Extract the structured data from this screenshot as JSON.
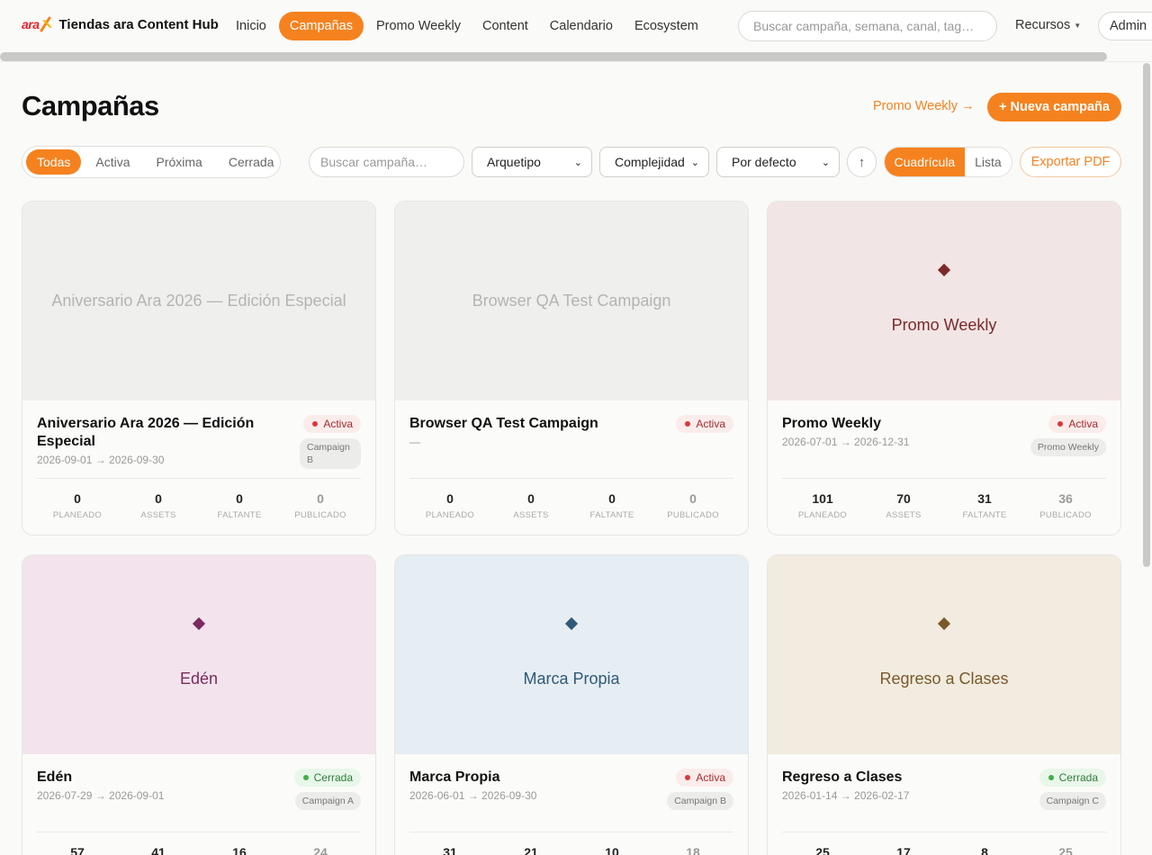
{
  "brand": {
    "logo_text": "ara",
    "title": "Tiendas ara Content Hub"
  },
  "nav": [
    {
      "label": "Inicio",
      "active": false
    },
    {
      "label": "Campañas",
      "active": true
    },
    {
      "label": "Promo Weekly",
      "active": false
    },
    {
      "label": "Content",
      "active": false
    },
    {
      "label": "Calendario",
      "active": false
    },
    {
      "label": "Ecosystem",
      "active": false
    }
  ],
  "top_search": {
    "placeholder": "Buscar campaña, semana, canal, tag…"
  },
  "resources_menu": {
    "label": "Recursos"
  },
  "user_menu": {
    "label": "Admin"
  },
  "header": {
    "title": "Campañas",
    "promo_link": "Promo Weekly →",
    "new_button": "+ Nueva campaña"
  },
  "filters": {
    "status_tabs": [
      {
        "label": "Todas",
        "active": true
      },
      {
        "label": "Activa",
        "active": false
      },
      {
        "label": "Próxima",
        "active": false
      },
      {
        "label": "Cerrada",
        "active": false
      }
    ],
    "search_placeholder": "Buscar campaña…",
    "archetype_select": "Arquetipo",
    "complexity_select": "Complejidad",
    "sort_select": "Por defecto",
    "sort_direction_icon": "↑",
    "view_grid": "Cuadrícula",
    "view_list": "Lista",
    "export": "Exportar PDF"
  },
  "colors": {
    "accent": "#f5821f",
    "active_badge": "#d83a3a",
    "closed_badge": "#3fae4b"
  },
  "stat_labels": [
    "PLANEADO",
    "ASSETS",
    "FALTANTE",
    "PUBLICADO"
  ],
  "campaigns": [
    {
      "cover_title": "Aniversario Ara 2026 — Edición Especial",
      "cover_color": "#efefed",
      "diamond_color": "",
      "title": "Aniversario Ara 2026 — Edición Especial",
      "dates": "2026-09-01 → 2026-09-30",
      "status": "Activa",
      "archetype": "Campaign B",
      "stats": [
        0,
        0,
        0,
        0
      ]
    },
    {
      "cover_title": "Browser QA Test Campaign",
      "cover_color": "#efefed",
      "diamond_color": "",
      "title": "Browser QA Test Campaign",
      "dates": "—",
      "status": "Activa",
      "archetype": "",
      "stats": [
        0,
        0,
        0,
        0
      ]
    },
    {
      "cover_title": "Promo Weekly",
      "cover_color": "#f2e5e5",
      "diamond_color": "#7a2a2a",
      "title": "Promo Weekly",
      "dates": "2026-07-01 → 2026-12-31",
      "status": "Activa",
      "archetype": "Promo Weekly",
      "stats": [
        101,
        70,
        31,
        36
      ]
    },
    {
      "cover_title": "Edén",
      "cover_color": "#f2e3ec",
      "diamond_color": "#7a2a5e",
      "title": "Edén",
      "dates": "2026-07-29 → 2026-09-01",
      "status": "Cerrada",
      "archetype": "Campaign A",
      "stats": [
        57,
        41,
        16,
        24
      ]
    },
    {
      "cover_title": "Marca Propia",
      "cover_color": "#e6edf3",
      "diamond_color": "#2f5a78",
      "title": "Marca Propia",
      "dates": "2026-06-01 → 2026-09-30",
      "status": "Activa",
      "archetype": "Campaign B",
      "stats": [
        31,
        21,
        10,
        18
      ]
    },
    {
      "cover_title": "Regreso a Clases",
      "cover_color": "#f1ebe0",
      "diamond_color": "#7a5a2a",
      "title": "Regreso a Clases",
      "dates": "2026-01-14 → 2026-02-17",
      "status": "Cerrada",
      "archetype": "Campaign C",
      "stats": [
        25,
        17,
        8,
        25
      ]
    }
  ]
}
